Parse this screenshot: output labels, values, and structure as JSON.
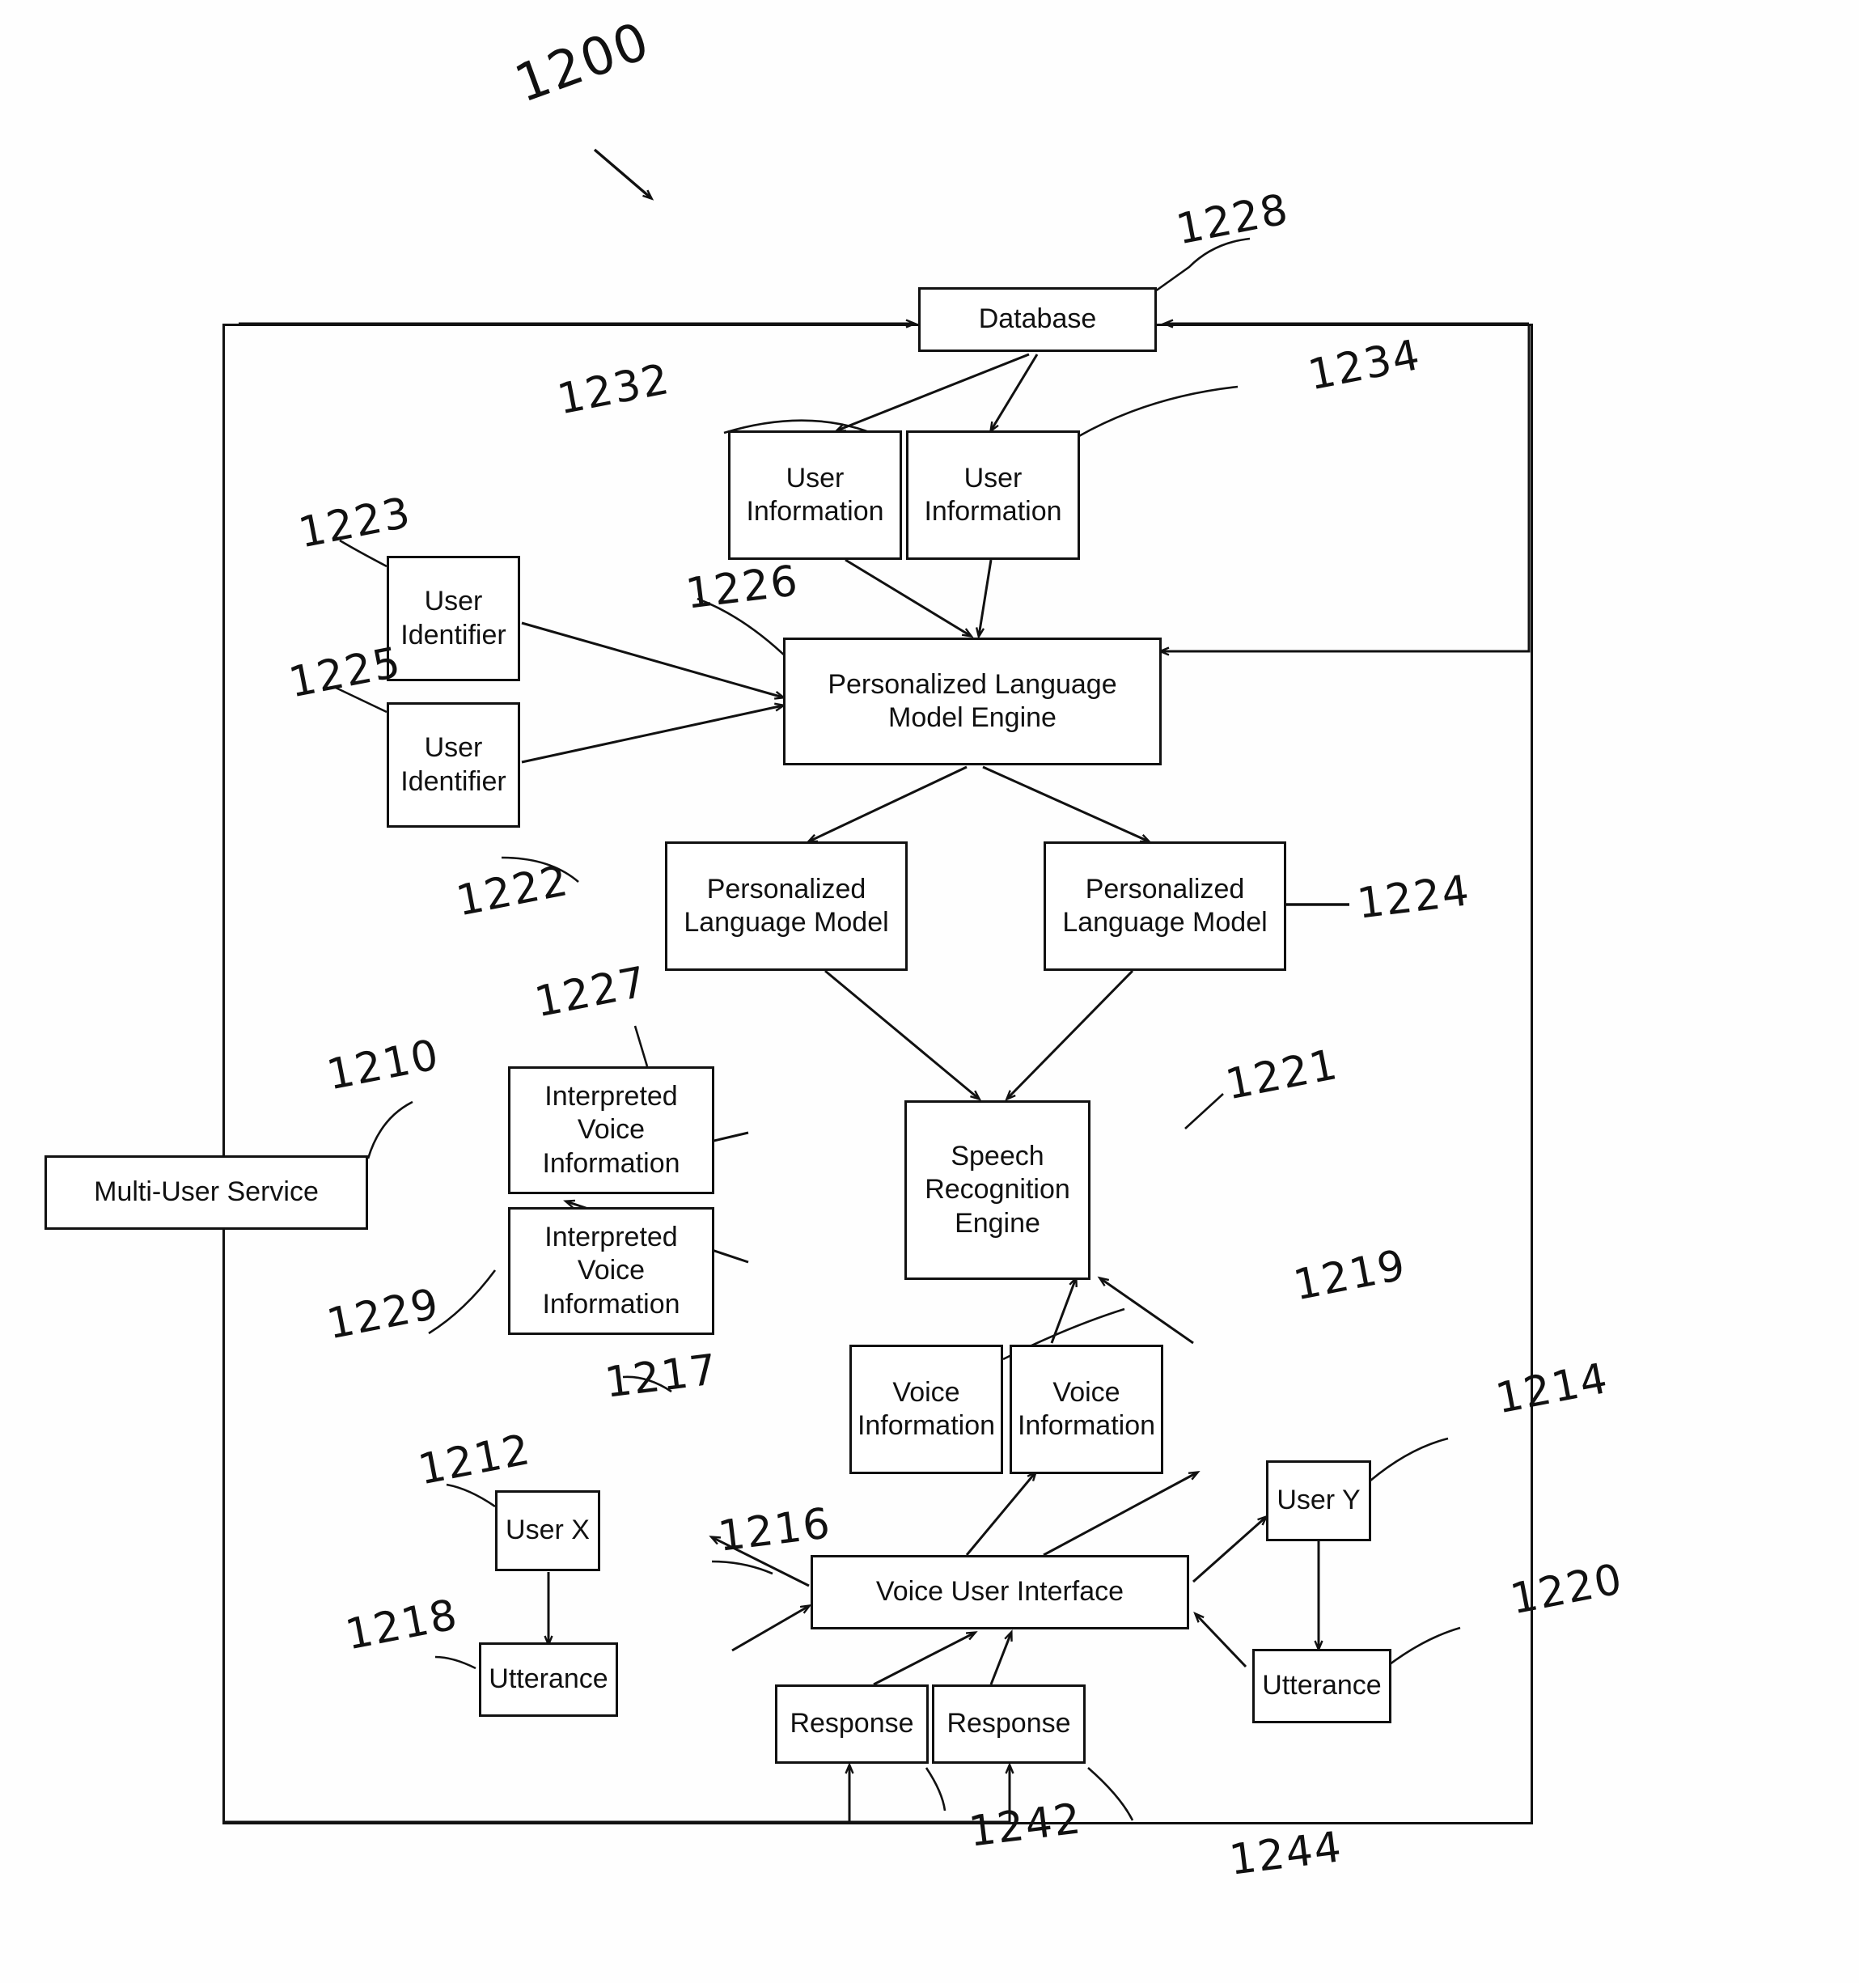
{
  "figure": {
    "number": "1200",
    "title_ref": "1200"
  },
  "nodes": {
    "database": {
      "label": "Database",
      "ref": "1228"
    },
    "user_info_left": {
      "label": "User\nInformation",
      "ref": "1232"
    },
    "user_info_right": {
      "label": "User\nInformation",
      "ref": "1234"
    },
    "user_identifier_top": {
      "label": "User\nIdentifier",
      "ref": "1223"
    },
    "user_identifier_bottom": {
      "label": "User\nIdentifier",
      "ref": "1225"
    },
    "plm_engine": {
      "label": "Personalized Language\nModel Engine",
      "ref": "1226"
    },
    "plm_left": {
      "label": "Personalized\nLanguage Model",
      "ref": "1222"
    },
    "plm_right": {
      "label": "Personalized\nLanguage Model",
      "ref": "1224"
    },
    "interpreted_voice_top": {
      "label": "Interpreted Voice\nInformation",
      "ref": "1227"
    },
    "interpreted_voice_bottom": {
      "label": "Interpreted Voice\nInformation",
      "ref": "1229"
    },
    "speech_recognition_engine": {
      "label": "Speech\nRecognition\nEngine",
      "ref": "1221"
    },
    "multi_user_service": {
      "label": "Multi-User Service",
      "ref": "1210"
    },
    "voice_info_left": {
      "label": "Voice\nInformation",
      "ref": "1217"
    },
    "voice_info_right": {
      "label": "Voice\nInformation",
      "ref": "1219"
    },
    "user_x": {
      "label": "User X",
      "ref": "1212"
    },
    "user_y": {
      "label": "User Y",
      "ref": "1214"
    },
    "utterance_left": {
      "label": "Utterance",
      "ref": "1218"
    },
    "utterance_right": {
      "label": "Utterance",
      "ref": "1220"
    },
    "voice_user_interface": {
      "label": "Voice User Interface",
      "ref": "1216"
    },
    "response_left": {
      "label": "Response",
      "ref": "1242"
    },
    "response_right": {
      "label": "Response",
      "ref": "1244"
    }
  },
  "reference_numerals": [
    "1200",
    "1228",
    "1232",
    "1234",
    "1223",
    "1225",
    "1226",
    "1222",
    "1224",
    "1227",
    "1210",
    "1229",
    "1221",
    "1219",
    "1217",
    "1212",
    "1216",
    "1214",
    "1218",
    "1220",
    "1242",
    "1244"
  ],
  "colors": {
    "ink": "#111111",
    "paper": "#fefefe"
  }
}
